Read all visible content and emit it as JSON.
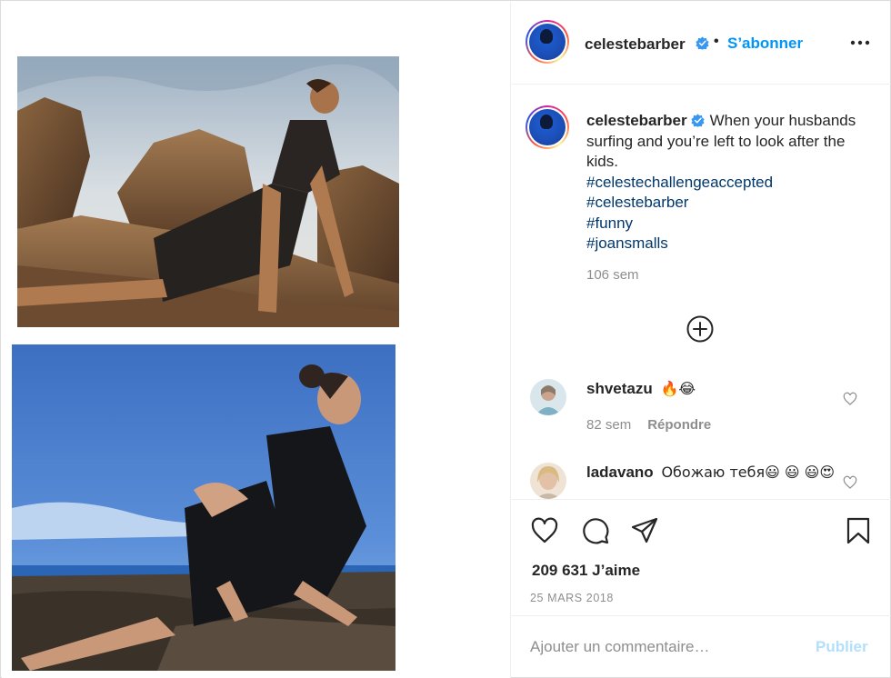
{
  "post": {
    "username": "celestebarber",
    "verified": true,
    "separator": "•",
    "follow_label": "S’abonner",
    "more_icon": "more-options-icon"
  },
  "caption": {
    "username": "celestebarber",
    "text": "When your husbands surfing and you’re left to look after the kids.",
    "hashtags": [
      "#celestechallengeaccepted",
      "#celestebarber",
      "#funny",
      "#joansmalls"
    ],
    "time": "106 sem",
    "load_more_icon": "plus-circle-icon"
  },
  "comments": [
    {
      "username": "shvetazu",
      "text": "🔥😂",
      "time": "82 sem",
      "reply_label": "Répondre"
    },
    {
      "username": "ladavano",
      "text": "Обожаю тебя😃 😃 😃😍",
      "time": "",
      "reply_label": ""
    }
  ],
  "actions": {
    "icons": [
      "heart-icon",
      "comment-icon",
      "share-icon",
      "bookmark-icon"
    ],
    "likes": "209 631 J’aime",
    "date": "25 MARS 2018"
  },
  "comment_box": {
    "placeholder": "Ajouter un commentaire…",
    "publish_label": "Publier"
  },
  "colors": {
    "link_blue": "#0095f6",
    "hashtag_blue": "#00376b",
    "muted": "#8e8e8e",
    "publish_disabled": "#b2dffc",
    "verified_blue": "#3897f0"
  }
}
